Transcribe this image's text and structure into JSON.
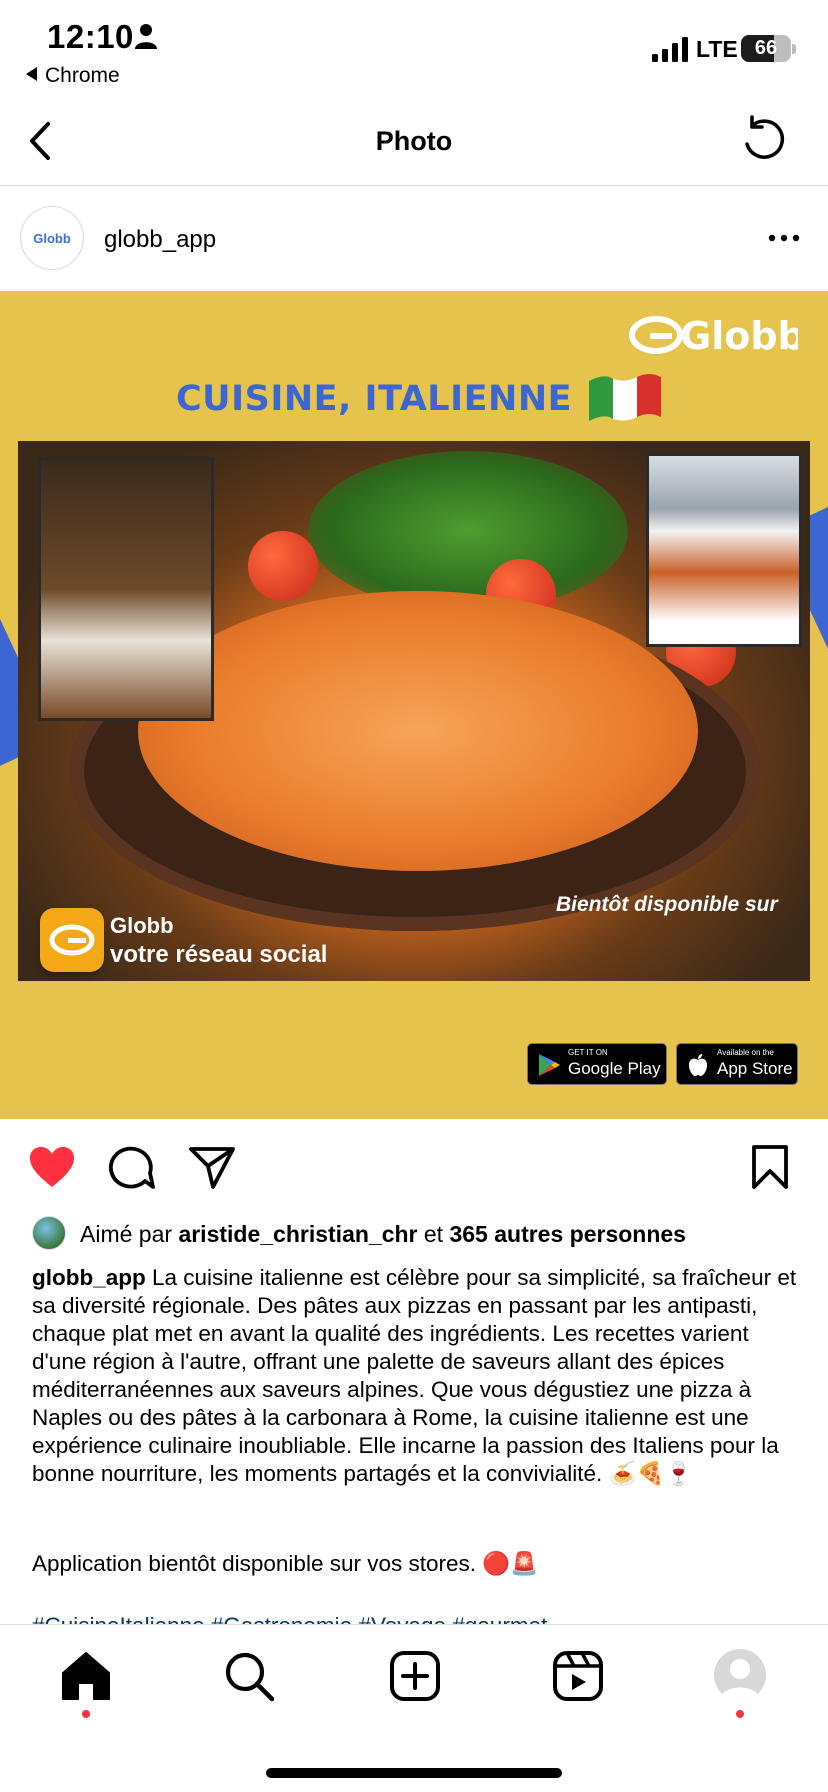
{
  "status_bar": {
    "time": "12:10",
    "back_app": "Chrome",
    "network": "LTE",
    "battery": "66",
    "battery_level": 0.66
  },
  "nav": {
    "title": "Photo"
  },
  "post": {
    "username": "globb_app",
    "avatar_logo": "Globb"
  },
  "promo": {
    "logo_text": "Globb",
    "title": "CUISINE, ITALIENNE",
    "brand": "Globb",
    "tagline": "votre réseau social",
    "soon": "Bientôt disponible sur",
    "google_small": "GET IT ON",
    "google_big": "Google Play",
    "apple_small": "Available on the",
    "apple_big": "App Store"
  },
  "likes": {
    "prefix": "Aimé par ",
    "liker": "aristide_christian_chr",
    "middle": " et ",
    "others": "365 autres personnes"
  },
  "caption": {
    "user": "globb_app",
    "text": " La cuisine italienne est célèbre pour sa simplicité, sa fraîcheur et sa diversité régionale. Des pâtes aux pizzas en passant par les antipasti, chaque plat met en avant la qualité des ingrédients. Les recettes varient d'une région à l'autre, offrant une palette de saveurs allant des épices méditerranéennes aux saveurs alpines. Que vous dégustiez une pizza à Naples ou des pâtes à la carbonara à Rome, la cuisine italienne est une expérience culinaire inoubliable. Elle incarne la passion des Italiens pour la bonne nourriture, les moments partagés et la convivialité. 🍝🍕🍷",
    "app_line": "Application bientôt disponible sur vos stores. 🔴🚨",
    "hashtags": "#CuisineItalienne #Gastronomie #Voyage #gourmet"
  },
  "icons": {
    "like": "heart-filled-icon",
    "comment": "comment-icon",
    "share": "send-icon",
    "save": "bookmark-icon",
    "home": "home-icon",
    "search": "search-icon",
    "create": "plus-square-icon",
    "reels": "reels-icon",
    "profile": "profile-icon"
  },
  "colors": {
    "like_red": "#ff3040",
    "promo_yellow": "#e5c34d",
    "promo_blue": "#3c67d3",
    "link_blue": "#00376b"
  }
}
